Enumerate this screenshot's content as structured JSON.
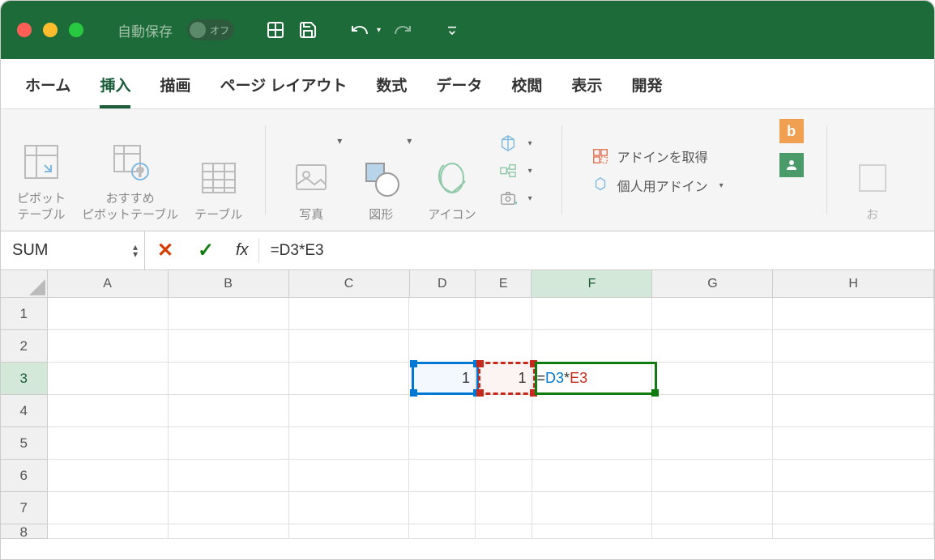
{
  "titlebar": {
    "autosave_label": "自動保存",
    "autosave_state": "オフ"
  },
  "tabs": [
    "ホーム",
    "挿入",
    "描画",
    "ページ レイアウト",
    "数式",
    "データ",
    "校閲",
    "表示",
    "開発"
  ],
  "active_tab": "挿入",
  "ribbon": {
    "pivot_table": "ピボット\nテーブル",
    "recommended_pivot": "おすすめ\nピボットテーブル",
    "table": "テーブル",
    "pictures": "写真",
    "shapes": "図形",
    "icons": "アイコン",
    "get_addins": "アドインを取得",
    "my_addins": "個人用アドイン"
  },
  "formula_bar": {
    "name_box": "SUM",
    "formula": "=D3*E3",
    "formula_parts": {
      "eq": "=",
      "ref1": "D3",
      "op": "*",
      "ref2": "E3"
    }
  },
  "columns": [
    "A",
    "B",
    "C",
    "D",
    "E",
    "F",
    "G",
    "H"
  ],
  "active_column": "F",
  "rows": [
    1,
    2,
    3,
    4,
    5,
    6,
    7,
    8
  ],
  "active_row": 3,
  "cells": {
    "D3": "1",
    "E3": "1",
    "F3_parts": {
      "eq": "=",
      "ref1": "D3",
      "op": "*",
      "ref2": "E3"
    }
  }
}
